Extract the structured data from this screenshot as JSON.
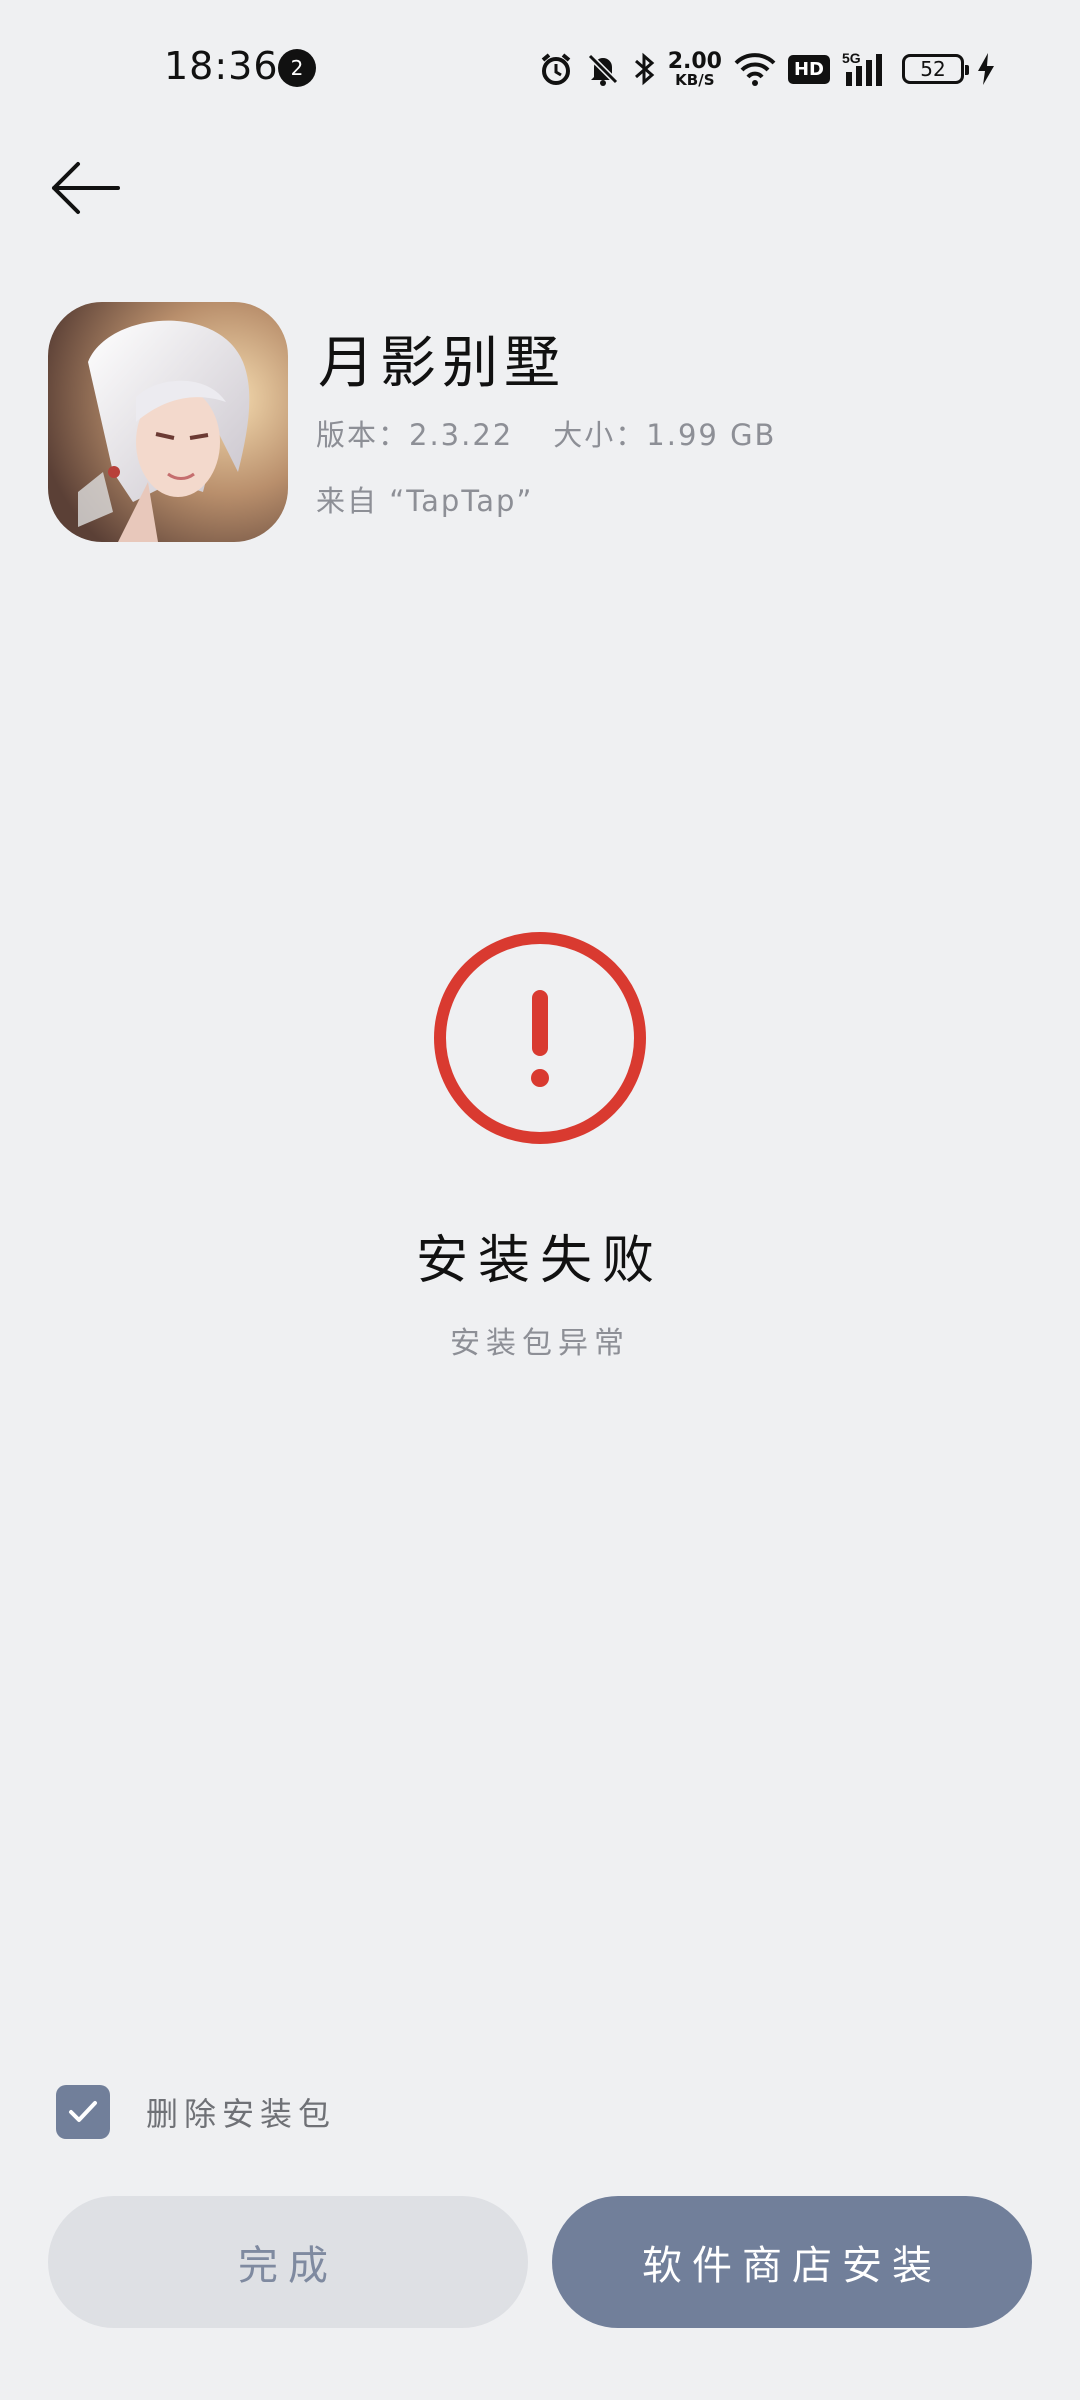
{
  "status_bar": {
    "time": "18:36",
    "notification_count": "2",
    "net_speed_value": "2.00",
    "net_speed_unit": "KB/S",
    "hd_label": "HD",
    "network_label": "5G",
    "battery_level": "52"
  },
  "app": {
    "name": "月影别墅",
    "version_label": "版本：",
    "version": "2.3.22",
    "size_label": "大小：",
    "size": "1.99 GB",
    "source": "来自 “TapTap”"
  },
  "result": {
    "title": "安装失败",
    "description": "安装包异常"
  },
  "options": {
    "delete_package_label": "删除安装包",
    "delete_package_checked": true
  },
  "actions": {
    "done_label": "完成",
    "store_install_label": "软件商店安装"
  },
  "colors": {
    "background": "#eff0f2",
    "error": "#d93a30",
    "primary_button": "#717f9a",
    "secondary_button": "#dee0e4"
  },
  "icons": {
    "back": "arrow-left-icon",
    "error": "exclamation-circle-icon",
    "checkbox": "checkmark-icon"
  }
}
